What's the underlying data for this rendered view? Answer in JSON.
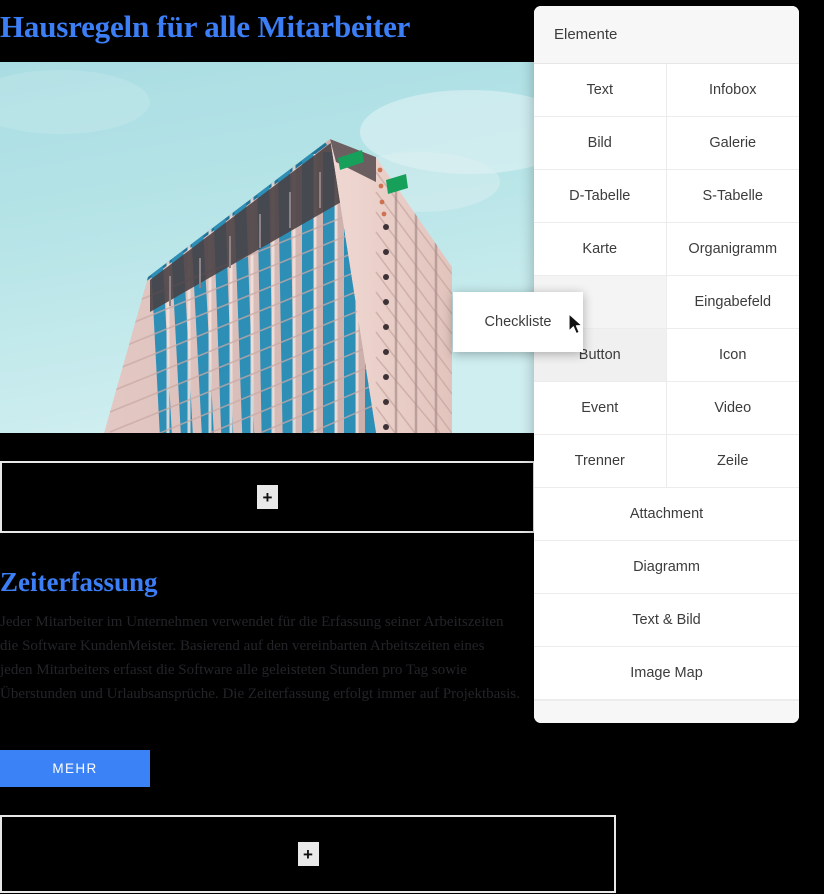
{
  "page": {
    "title": "Hausregeln für alle Mitarbeiter",
    "section_title": "Zeiterfassung",
    "body_text": "Jeder Mitarbeiter im Unternehmen verwendet für die Erfassung seiner Arbeitszeiten die Software KundenMeister. Basierend auf den vereinbarten Arbeitszeiten eines jeden Mitarbeiters erfasst die Software alle geleisteten Stunden pro Tag sowie Überstunden und Urlaubsansprüche. Die Zeiterfassung erfolgt immer auf Projektbasis.",
    "more_button": "MEHR",
    "add_symbol": "+",
    "hero_image_alt": "skyscraper-photo",
    "colors": {
      "heading": "#3b7ef5",
      "button": "#3b82f6",
      "background": "#000000",
      "panel": "#ffffff"
    }
  },
  "panel": {
    "header": "Elemente",
    "items": [
      {
        "label": "Text",
        "span": "half",
        "state": "normal"
      },
      {
        "label": "Infobox",
        "span": "half",
        "state": "normal"
      },
      {
        "label": "Bild",
        "span": "half",
        "state": "normal"
      },
      {
        "label": "Galerie",
        "span": "half",
        "state": "normal"
      },
      {
        "label": "D-Tabelle",
        "span": "half",
        "state": "normal"
      },
      {
        "label": "S-Tabelle",
        "span": "half",
        "state": "normal"
      },
      {
        "label": "Karte",
        "span": "half",
        "state": "normal"
      },
      {
        "label": "Organigramm",
        "span": "half",
        "state": "normal"
      },
      {
        "label": "Checkliste",
        "span": "half",
        "state": "dragging"
      },
      {
        "label": "Eingabefeld",
        "span": "half",
        "state": "normal"
      },
      {
        "label": "Button",
        "span": "half",
        "state": "hovered"
      },
      {
        "label": "Icon",
        "span": "half",
        "state": "normal"
      },
      {
        "label": "Event",
        "span": "half",
        "state": "normal"
      },
      {
        "label": "Video",
        "span": "half",
        "state": "normal"
      },
      {
        "label": "Trenner",
        "span": "half",
        "state": "normal"
      },
      {
        "label": "Zeile",
        "span": "half",
        "state": "normal"
      },
      {
        "label": "Attachment",
        "span": "full",
        "state": "normal"
      },
      {
        "label": "Diagramm",
        "span": "full",
        "state": "normal"
      },
      {
        "label": "Text & Bild",
        "span": "full",
        "state": "normal"
      },
      {
        "label": "Image Map",
        "span": "full",
        "state": "normal"
      }
    ]
  },
  "drag": {
    "ghost_label": "Checkliste",
    "cursor": "arrow-cursor"
  }
}
